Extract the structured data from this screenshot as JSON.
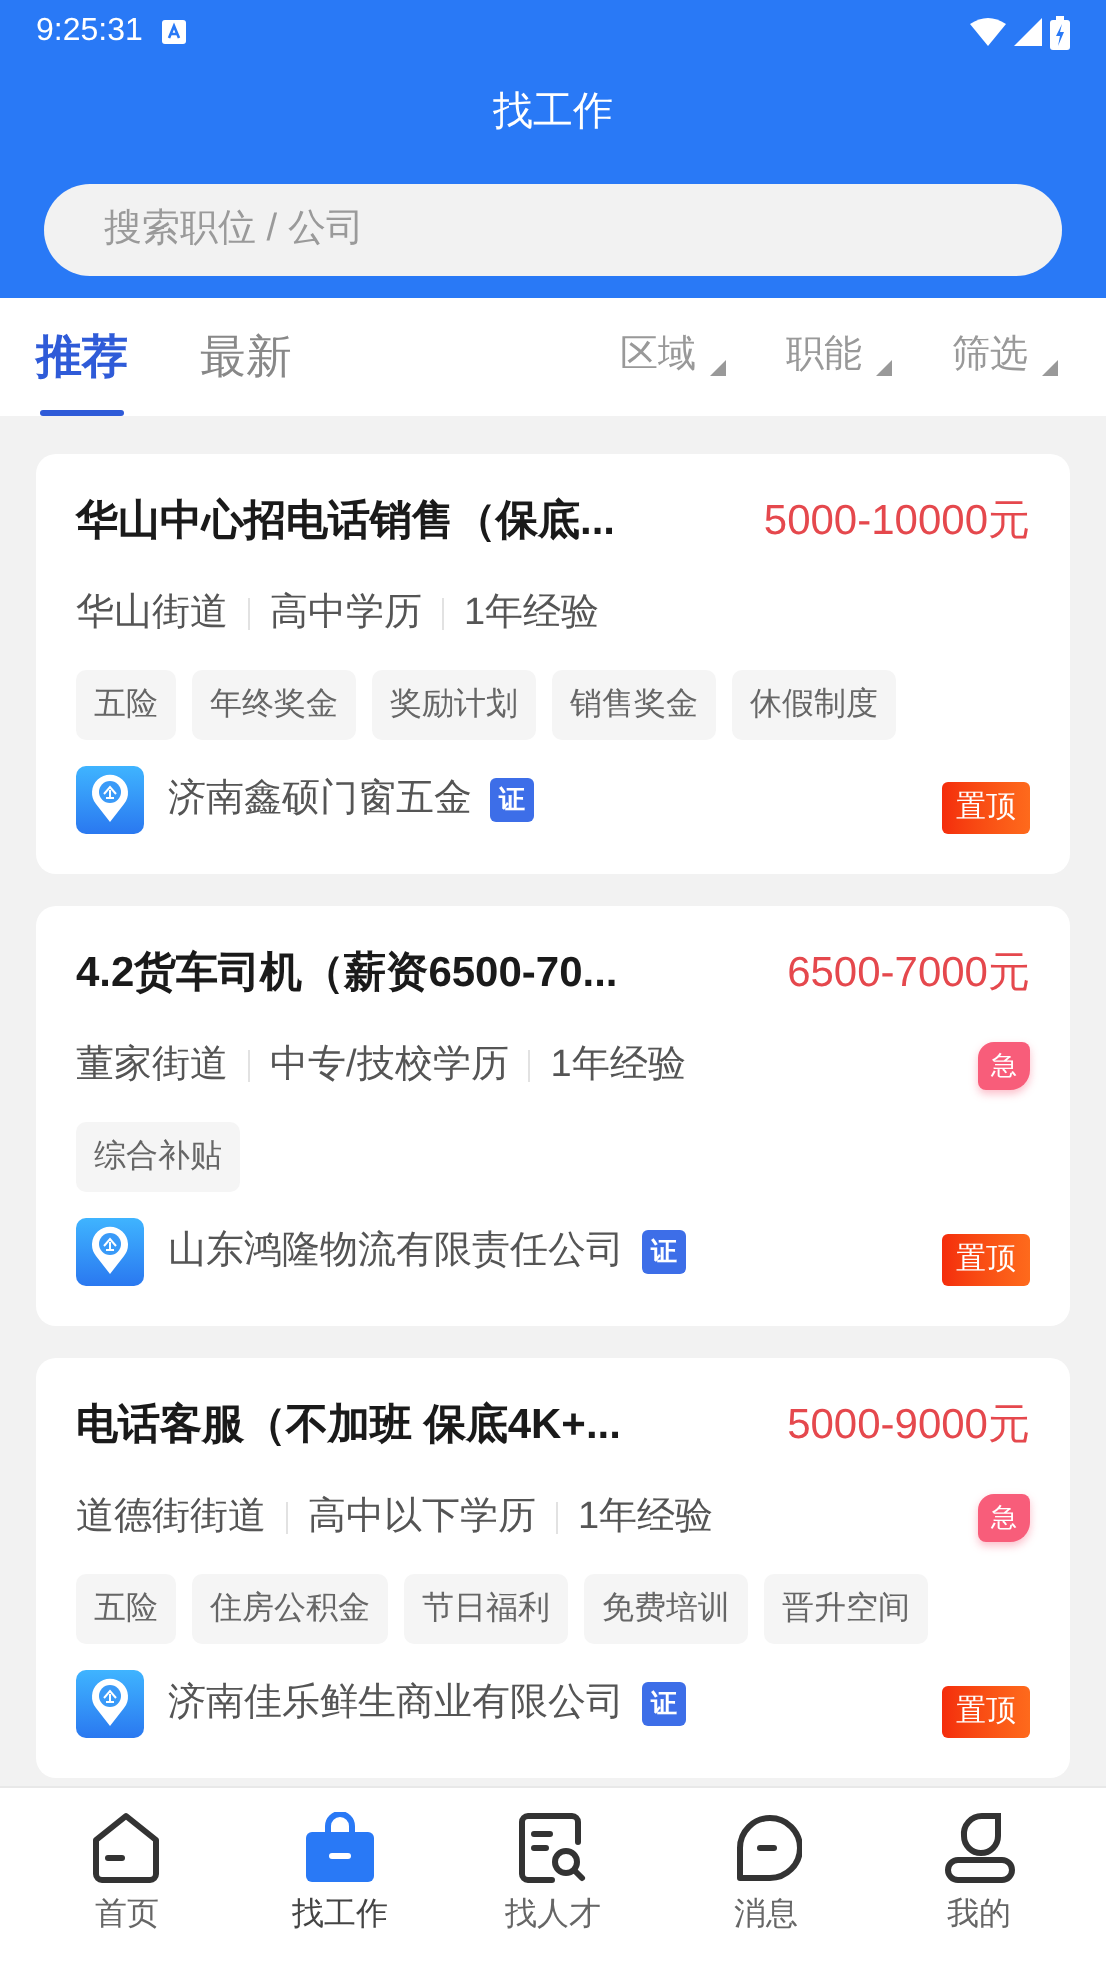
{
  "status_bar": {
    "time": "9:25:31"
  },
  "header": {
    "title": "找工作"
  },
  "search": {
    "placeholder": "搜索职位 / 公司"
  },
  "tabs": [
    {
      "label": "推荐",
      "selected": true
    },
    {
      "label": "最新",
      "selected": false
    }
  ],
  "filters": [
    {
      "label": "区域"
    },
    {
      "label": "职能"
    },
    {
      "label": "筛选"
    }
  ],
  "jobs": [
    {
      "title": "华山中心招电话销售（保底...",
      "salary": "5000-10000元",
      "meta": [
        "华山街道",
        "高中学历",
        "1年经验"
      ],
      "tags": [
        "五险",
        "年终奖金",
        "奖励计划",
        "销售奖金",
        "休假制度"
      ],
      "company": "济南鑫硕门窗五金",
      "verified_badge": "证",
      "pin_badge": "置顶"
    },
    {
      "title": "4.2货车司机（薪资6500-70...",
      "salary": "6500-7000元",
      "meta": [
        "董家街道",
        "中专/技校学历",
        "1年经验"
      ],
      "urgent_badge": "急",
      "tags": [
        "综合补贴"
      ],
      "company": "山东鸿隆物流有限责任公司",
      "verified_badge": "证",
      "pin_badge": "置顶"
    },
    {
      "title": "电话客服（不加班 保底4K+...",
      "salary": "5000-9000元",
      "meta": [
        "道德街街道",
        "高中以下学历",
        "1年经验"
      ],
      "urgent_badge": "急",
      "tags": [
        "五险",
        "住房公积金",
        "节日福利",
        "免费培训",
        "晋升空间"
      ],
      "company": "济南佳乐鲜生商业有限公司",
      "verified_badge": "证",
      "pin_badge": "置顶"
    }
  ],
  "nav": [
    {
      "label": "首页",
      "kind": "home",
      "selected": false
    },
    {
      "label": "找工作",
      "kind": "jobs",
      "selected": true
    },
    {
      "label": "找人才",
      "kind": "talent",
      "selected": false
    },
    {
      "label": "消息",
      "kind": "messages",
      "selected": false
    },
    {
      "label": "我的",
      "kind": "profile",
      "selected": false
    }
  ]
}
